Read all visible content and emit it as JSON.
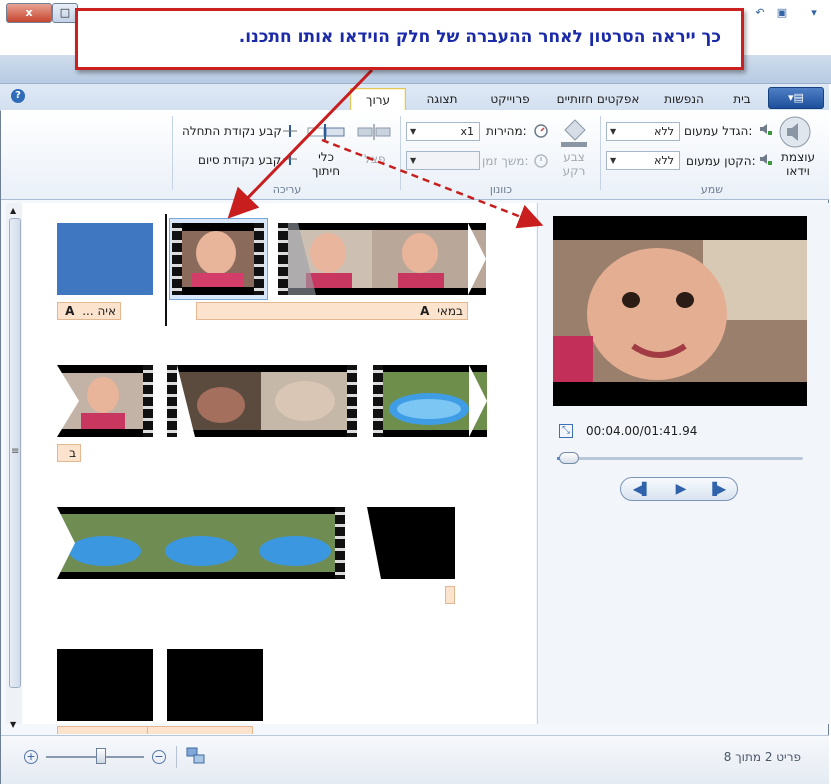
{
  "annotation": {
    "text": "כך ייראה הסרטון לאחר ההעברה של חלק הוידאו אותו חתכנו."
  },
  "window": {
    "close_label": "x",
    "max_label": "□"
  },
  "app_menu": {
    "label": "▾▤"
  },
  "tabs": [
    {
      "label": "בית",
      "active": false
    },
    {
      "label": "הנפשות",
      "active": false
    },
    {
      "label": "אפקטים חזותיים",
      "active": false
    },
    {
      "label": "פרוייקט",
      "active": false
    },
    {
      "label": "תצוגה",
      "active": false
    },
    {
      "label": "ערוך",
      "active": true
    }
  ],
  "ribbon": {
    "audio": {
      "group_label": "שמע",
      "volume_label": "עוצמת",
      "volume_label2": "וידאו",
      "fade_in_label": "הגדל עמעום:",
      "fade_in_value": "ללא",
      "fade_out_label": "הקטן עמעום:",
      "fade_out_value": "ללא"
    },
    "adjust": {
      "group_label": "כוונון",
      "bg_color_label": "צבע",
      "bg_color_label2": "רקע",
      "speed_label": "מהירות:",
      "speed_value": "x1",
      "duration_label": "משך זמן:",
      "duration_value": ""
    },
    "editing": {
      "group_label": "עריכה",
      "trim_tool_label": "כלי",
      "trim_tool_label2": "חיתוך",
      "split_label": "פצל",
      "set_start_label": "קבע נקודת התחלה",
      "set_end_label": "קבע נקודת סיום"
    }
  },
  "storyboard": {
    "captions": {
      "row1_left": "איה ...",
      "row1_right": "במאי",
      "row2": "ב"
    }
  },
  "preview": {
    "time": "00:04.00/01:41.94",
    "seek_progress": 0.04
  },
  "status": {
    "item_text": "פריט 2 מתוך 8"
  },
  "colors": {
    "accent_red": "#cc1f1f",
    "callout_text": "#1a2aa8",
    "caption_bg": "#fbe3cd",
    "blue_tile": "#3f77c0"
  }
}
